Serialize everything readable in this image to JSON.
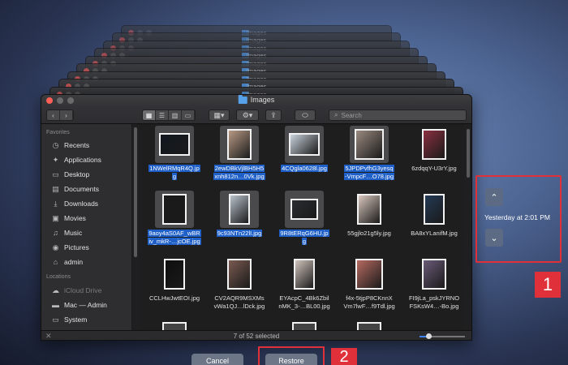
{
  "window": {
    "title": "Images",
    "search_placeholder": "Search",
    "status": "7 of 52 selected"
  },
  "stack_titles": [
    "Images",
    "Images",
    "Images",
    "Images",
    "Images",
    "Images",
    "Images",
    "Images",
    "Images"
  ],
  "sidebar": {
    "favorites_header": "Favorites",
    "favorites": [
      {
        "label": "Recents",
        "icon": "clock-icon"
      },
      {
        "label": "Applications",
        "icon": "applications-icon"
      },
      {
        "label": "Desktop",
        "icon": "desktop-icon"
      },
      {
        "label": "Documents",
        "icon": "document-icon"
      },
      {
        "label": "Downloads",
        "icon": "download-icon"
      },
      {
        "label": "Movies",
        "icon": "film-icon"
      },
      {
        "label": "Music",
        "icon": "music-icon"
      },
      {
        "label": "Pictures",
        "icon": "camera-icon"
      },
      {
        "label": "admin",
        "icon": "home-icon"
      }
    ],
    "locations_header": "Locations",
    "locations": [
      {
        "label": "iCloud Drive",
        "icon": "cloud-icon"
      },
      {
        "label": "Mac — Admin",
        "icon": "computer-icon"
      },
      {
        "label": "System",
        "icon": "disk-icon"
      }
    ]
  },
  "files": [
    {
      "line1": "1NWelRMqR4Q.jp",
      "line2": "g",
      "selected": true,
      "tone": "#111820",
      "w": 38,
      "h": 28
    },
    {
      "line1": "2ewDBkVjlBH5H5",
      "line2": "xnh812n…0Vk.jpg",
      "selected": true,
      "tone": "#b89a86",
      "w": 30,
      "h": 38
    },
    {
      "line1": "4CQgla0628l.jpg",
      "line2": "",
      "selected": true,
      "tone": "#c9d2dc",
      "w": 38,
      "h": 28
    },
    {
      "line1": "5JPDPvfhG3yesq",
      "line2": "-VmpcF…O78.jpg",
      "selected": true,
      "tone": "#9a8a80",
      "w": 36,
      "h": 38
    },
    {
      "line1": "6zdqqY-U3rY.jpg",
      "line2": "",
      "selected": false,
      "tone": "#8a3040",
      "w": 30,
      "h": 38
    },
    {
      "line1": "9aoy4aS0AF_wBR",
      "line2": "iv_mkR-…jcOE.jpg",
      "selected": true,
      "tone": "#1a1a1a",
      "w": 30,
      "h": 38
    },
    {
      "line1": "9c93NTn22lI.jpg",
      "line2": "",
      "selected": true,
      "tone": "#b9c2cc",
      "w": 26,
      "h": 38
    },
    {
      "line1": "9R8tERqG6HU.jp",
      "line2": "g",
      "selected": true,
      "tone": "#2a2c30",
      "w": 34,
      "h": 26
    },
    {
      "line1": "55gjlo21g5ly.jpg",
      "line2": "",
      "selected": false,
      "tone": "#d9c7bd",
      "w": 30,
      "h": 38
    },
    {
      "line1": "BA8xYLanifM.jpg",
      "line2": "",
      "selected": false,
      "tone": "#243a55",
      "w": 26,
      "h": 38
    },
    {
      "line1": "CCLHwJwtEOI.jpg",
      "line2": "",
      "selected": false,
      "tone": "#0e0e0e",
      "w": 26,
      "h": 38
    },
    {
      "line1": "CV2AQR9MSXMs",
      "line2": "vWa1QJ…lDck.jpg",
      "selected": false,
      "tone": "#7a5a50",
      "w": 30,
      "h": 38
    },
    {
      "line1": "EYAcpC_4Bk6Zbil",
      "line2": "nMK_3-…BL00.jpg",
      "selected": false,
      "tone": "#d0c4bc",
      "w": 26,
      "h": 38
    },
    {
      "line1": "f4x-5tjpP8CKnnX",
      "line2": "Vm7lwF…f9Tdl.jpg",
      "selected": false,
      "tone": "#b66a60",
      "w": 34,
      "h": 38
    },
    {
      "line1": "FI9jLa_pskJYRNO",
      "line2": "FSKsW4…-Bo.jpg",
      "selected": false,
      "tone": "#6a5a78",
      "w": 30,
      "h": 38
    }
  ],
  "time_machine": {
    "timestamp": "Yesterday at 2:01 PM",
    "up_glyph": "⌃",
    "down_glyph": "⌄"
  },
  "buttons": {
    "cancel": "Cancel",
    "restore": "Restore"
  },
  "badges": {
    "one": "1",
    "two": "2"
  }
}
